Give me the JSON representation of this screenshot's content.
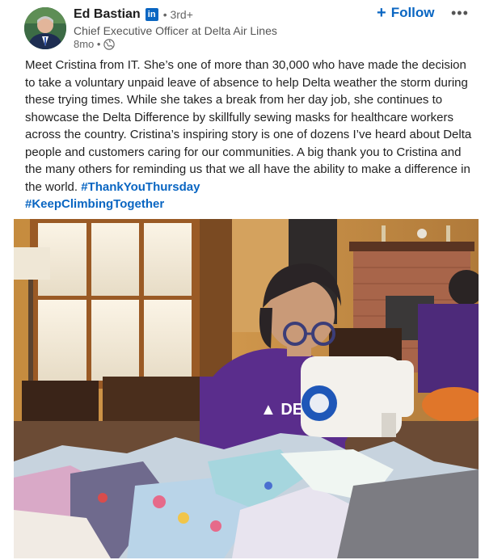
{
  "author": {
    "name": "Ed Bastian",
    "badge": "in",
    "degree": "• 3rd+",
    "headline": "Chief Executive Officer at Delta Air Lines",
    "time": "8mo •",
    "avatar_icon": "person-avatar"
  },
  "actions": {
    "follow_plus": "+",
    "follow_label": "Follow",
    "more_label": "•••"
  },
  "post": {
    "body": "Meet Cristina from IT. She’s one of more than 30,000 who have made the decision to take a voluntary unpaid leave of absence to help Delta weather the storm during these trying times. While she takes a break from her day job, she continues to showcase the Delta Difference by skillfully sewing masks for healthcare workers across the country. Cristina’s inspiring story is one of dozens I’ve heard about Delta people and customers caring for our communities. A big thank you to Cristina and the many others for reminding us that we all have the ability to make a difference in the world. ",
    "hashtags": [
      "#ThankYouThursday",
      "#KeepClimbingTogether"
    ]
  },
  "photo": {
    "shirt_text": "DE",
    "subject": "woman sewing masks"
  },
  "colors": {
    "linkedin_blue": "#0a66c2",
    "shirt_purple": "#5a2d8c"
  }
}
